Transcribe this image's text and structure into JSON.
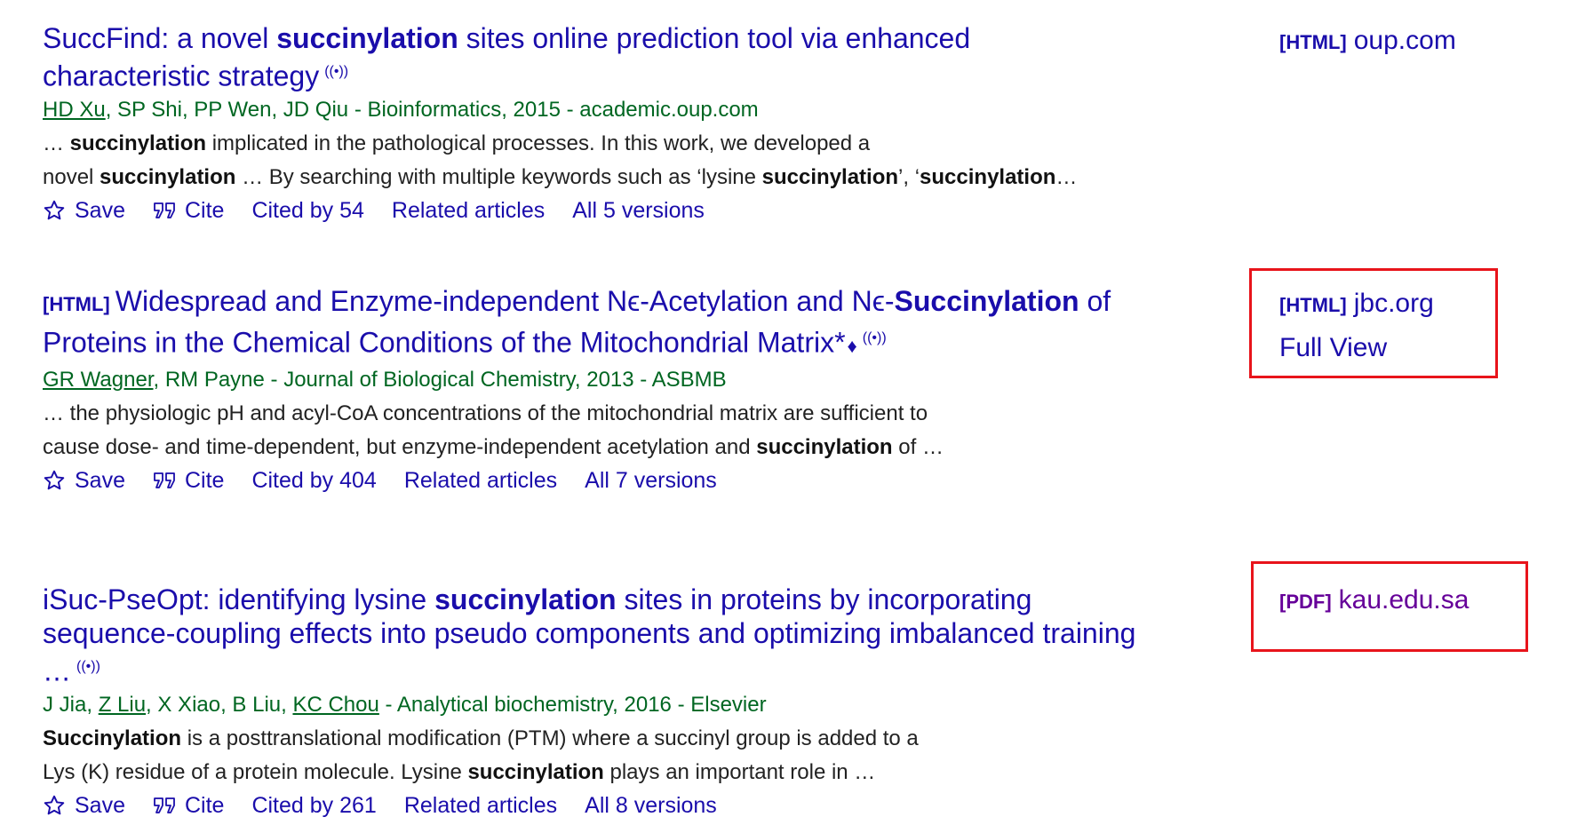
{
  "results": [
    {
      "title_pre": "SuccFind: a novel ",
      "title_bold": "succinylation",
      "title_post": " sites online prediction tool via enhanced characteristic strategy",
      "audio_icon": "((•))",
      "author1": "HD Xu",
      "meta_rest": ", SP Shi, PP Wen, JD Qiu - Bioinformatics, 2015 - academic.oup.com",
      "snip1_a": "… ",
      "snip1_b": "succinylation",
      "snip1_c": " implicated in the pathological processes. In this work, we developed a",
      "snip2_a": "novel ",
      "snip2_b": "succinylation",
      "snip2_c": " … By searching with multiple keywords such as ‘lysine ",
      "snip2_d": "succinylation",
      "snip2_e": "’, ‘",
      "snip2_f": "succinylation",
      "snip2_g": "…",
      "save": "Save",
      "cite": "Cite",
      "cited_by": "Cited by 54",
      "related": "Related articles",
      "versions": "All 5 versions",
      "side_tag": "[HTML]",
      "side_link": "oup.com"
    },
    {
      "title_tag": "[HTML]",
      "title_pre": "Widespread and Enzyme-independent Nϵ-Acetylation and Nϵ-",
      "title_bold": "Succinylation",
      "title_post": " of Proteins in the Chemical Conditions of the Mitochondrial Matrix*",
      "diamond": "♦",
      "audio_icon": "((•))",
      "author1": "GR Wagner",
      "meta_rest": ", RM Payne - Journal of Biological Chemistry, 2013 - ASBMB",
      "snip1": "… the physiologic pH and acyl-CoA concentrations of the mitochondrial matrix are sufficient to",
      "snip2_a": "cause dose- and time-dependent, but enzyme-independent acetylation and ",
      "snip2_b": "succinylation",
      "snip2_c": " of …",
      "save": "Save",
      "cite": "Cite",
      "cited_by": "Cited by 404",
      "related": "Related articles",
      "versions": "All 7 versions",
      "side_tag": "[HTML]",
      "side_link": "jbc.org",
      "side_full_view": "Full View"
    },
    {
      "title_pre": "iSuc-PseOpt: identifying lysine ",
      "title_bold": "succinylation",
      "title_post": " sites in proteins by incorporating sequence-coupling effects into pseudo components and optimizing imbalanced training …",
      "audio_icon": "((•))",
      "meta_a": "J Jia, ",
      "author_u1": "Z Liu",
      "meta_b": ", X Xiao, B Liu, ",
      "author_u2": "KC Chou",
      "meta_c": " - Analytical biochemistry, 2016 - Elsevier",
      "snip1_a": "Succinylation",
      "snip1_b": " is a posttranslational modification (PTM) where a succinyl group is added to a",
      "snip2_a": "Lys (K) residue of a protein molecule. Lysine ",
      "snip2_b": "succinylation",
      "snip2_c": " plays an important role in …",
      "save": "Save",
      "cite": "Cite",
      "cited_by": "Cited by 261",
      "related": "Related articles",
      "versions": "All 8 versions",
      "side_tag": "[PDF]",
      "side_link": "kau.edu.sa"
    }
  ],
  "colors": {
    "link": "#1a0dab",
    "meta_green": "#006621",
    "visited": "#660099",
    "highlight_box": "#e8141b"
  },
  "icons": {
    "save": "star-icon",
    "cite": "quote-icon",
    "audio": "audio-icon"
  }
}
